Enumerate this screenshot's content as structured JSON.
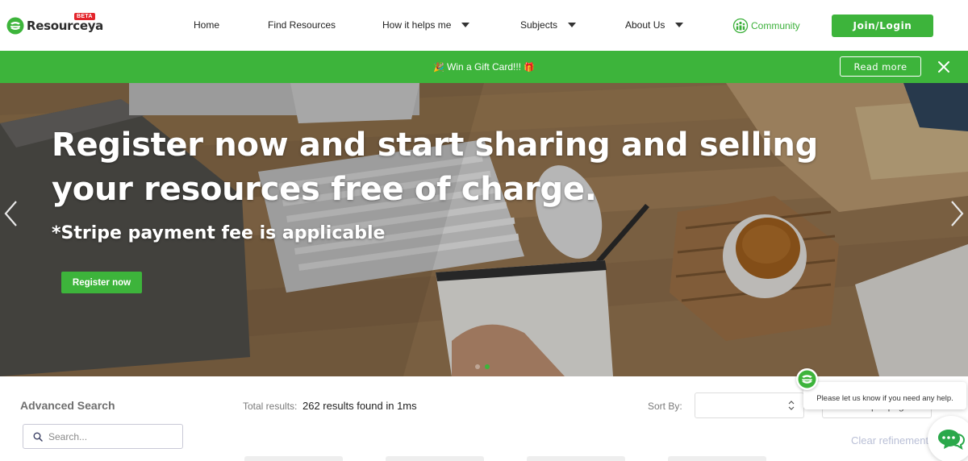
{
  "nav": {
    "logo_text": "Resource",
    "logo_text_suffix": "ya",
    "beta_badge": "BETA",
    "home": "Home",
    "find_resources": "Find Resources",
    "how_it_helps": "How it helps me",
    "subjects": "Subjects",
    "about_us": "About Us",
    "community": "Community",
    "join_login": "Join/Login"
  },
  "promo": {
    "text": "Win a Gift Card!!!",
    "leading_icon": "party-popper-icon",
    "trailing_icon": "gift-icon",
    "read_more": "Read more",
    "close_icon": "close-icon"
  },
  "hero": {
    "title": "Register now and start sharing and selling your resources free of charge.",
    "subtitle": "*Stripe payment fee is applicable",
    "cta": "Register now",
    "slides": 2,
    "active_slide": 2
  },
  "search": {
    "advanced_title": "Advanced Search",
    "placeholder": "Search...",
    "total_label": "Total results:",
    "total_value": "262 results found in 1ms",
    "sort_label": "Sort By:",
    "sort_value": "",
    "per_page_value": "per page",
    "clear": "Clear refinement"
  },
  "chat": {
    "message": "Please let us know if you need any help."
  },
  "colors": {
    "brand_green": "#3db43b",
    "beta_red": "#e3242b"
  }
}
